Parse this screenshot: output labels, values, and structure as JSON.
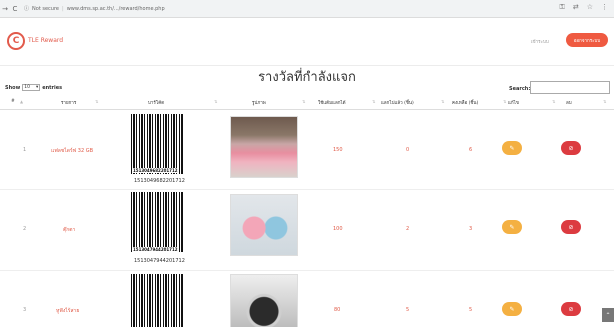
{
  "browser": {
    "security_label": "Not secure",
    "url": "www.dms.sp.ac.th/.../reward/home.php"
  },
  "header": {
    "brand": "TLE Reward",
    "user_link": "เข้าระบบ",
    "logout_label": "ออกจากระบบ"
  },
  "page": {
    "title": "รางวัลที่กำลังแจก"
  },
  "table_controls": {
    "show_label": "Show",
    "page_size": "10",
    "entries_label": "entries",
    "search_label": "Search:"
  },
  "table": {
    "columns": [
      "#",
      "รายการ",
      "บาร์โค้ด",
      "รูปภาพ",
      "ใช้แต้มแลกได้",
      "แลกไปแล้ว (ชิ้น)",
      "คงเหลือ (ชิ้น)",
      "แก้ไข",
      "ลบ"
    ],
    "rows": [
      {
        "no": "1",
        "name": "แฟลชไดร์ฟ 32 GB",
        "barcode": "1513049682201712",
        "points": "150",
        "exchanged": "0",
        "remaining": "6"
      },
      {
        "no": "2",
        "name": "ตุ๊กตา",
        "barcode": "1513047944201712",
        "points": "100",
        "exchanged": "2",
        "remaining": "3"
      },
      {
        "no": "3",
        "name": "หูฟังไร้สาย",
        "barcode": "",
        "points": "80",
        "exchanged": "5",
        "remaining": "5"
      }
    ]
  },
  "icons": {
    "edit": "pencil-icon",
    "delete": "ban-icon"
  },
  "colors": {
    "accent": "#ef5a41",
    "edit": "#f4b042",
    "delete": "#dc3b40"
  }
}
